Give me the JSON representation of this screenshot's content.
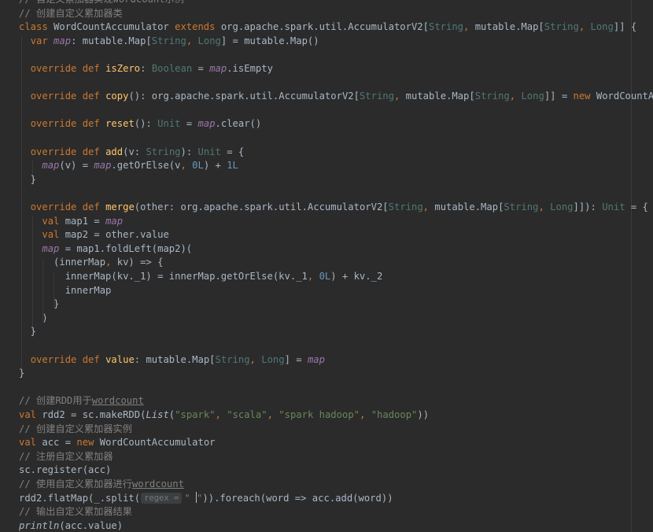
{
  "editor": {
    "theme_colors": {
      "background": "#2b2b2b",
      "text": "#a9b7c6",
      "keyword": "#cc7832",
      "type": "#507874",
      "function": "#ffc66d",
      "member": "#9876aa",
      "string": "#6a8759",
      "number": "#6897bb",
      "comment": "#808080"
    },
    "lines": [
      [
        {
          "t": "// 自定义累加器实现wordcount示例",
          "c": "c"
        }
      ],
      [
        {
          "t": "// 创建自定义累加器类",
          "c": "c"
        }
      ],
      [
        {
          "t": "class",
          "c": "k"
        },
        {
          "t": " WordCountAccumulator "
        },
        {
          "t": "extends",
          "c": "k"
        },
        {
          "t": " org.apache.spark.util.AccumulatorV2["
        },
        {
          "t": "String",
          "c": "t"
        },
        {
          "t": ", ",
          "c": "k"
        },
        {
          "t": "mutable.Map["
        },
        {
          "t": "String",
          "c": "t"
        },
        {
          "t": ", ",
          "c": "k"
        },
        {
          "t": "Long",
          "c": "t"
        },
        {
          "t": "]] {"
        }
      ],
      [
        {
          "t": "  "
        },
        {
          "t": "var",
          "c": "k"
        },
        {
          "t": " "
        },
        {
          "t": "map",
          "c": "m"
        },
        {
          "t": ": mutable.Map["
        },
        {
          "t": "String",
          "c": "t"
        },
        {
          "t": ", ",
          "c": "k"
        },
        {
          "t": "Long",
          "c": "t"
        },
        {
          "t": "] = mutable.Map()"
        }
      ],
      [],
      [
        {
          "t": "  "
        },
        {
          "t": "override def",
          "c": "k"
        },
        {
          "t": " "
        },
        {
          "t": "isZero",
          "c": "f"
        },
        {
          "t": ": "
        },
        {
          "t": "Boolean",
          "c": "t"
        },
        {
          "t": " = "
        },
        {
          "t": "map",
          "c": "m"
        },
        {
          "t": ".isEmpty"
        }
      ],
      [],
      [
        {
          "t": "  "
        },
        {
          "t": "override def",
          "c": "k"
        },
        {
          "t": " "
        },
        {
          "t": "copy",
          "c": "f"
        },
        {
          "t": "(): org.apache.spark.util.AccumulatorV2["
        },
        {
          "t": "String",
          "c": "t"
        },
        {
          "t": ", ",
          "c": "k"
        },
        {
          "t": "mutable.Map["
        },
        {
          "t": "String",
          "c": "t"
        },
        {
          "t": ", ",
          "c": "k"
        },
        {
          "t": "Long",
          "c": "t"
        },
        {
          "t": "]] = "
        },
        {
          "t": "new",
          "c": "k"
        },
        {
          "t": " WordCountAccumulator"
        }
      ],
      [],
      [
        {
          "t": "  "
        },
        {
          "t": "override def",
          "c": "k"
        },
        {
          "t": " "
        },
        {
          "t": "reset",
          "c": "f"
        },
        {
          "t": "(): "
        },
        {
          "t": "Unit",
          "c": "t"
        },
        {
          "t": " = "
        },
        {
          "t": "map",
          "c": "m"
        },
        {
          "t": ".clear()"
        }
      ],
      [],
      [
        {
          "t": "  "
        },
        {
          "t": "override def",
          "c": "k"
        },
        {
          "t": " "
        },
        {
          "t": "add",
          "c": "f"
        },
        {
          "t": "(v: "
        },
        {
          "t": "String",
          "c": "t"
        },
        {
          "t": "): "
        },
        {
          "t": "Unit",
          "c": "t"
        },
        {
          "t": " = {"
        }
      ],
      [
        {
          "t": "    "
        },
        {
          "t": "map",
          "c": "m"
        },
        {
          "t": "(v) = "
        },
        {
          "t": "map",
          "c": "m"
        },
        {
          "t": ".getOrElse(v"
        },
        {
          "t": ", ",
          "c": "k"
        },
        {
          "t": "0L",
          "c": "n"
        },
        {
          "t": ") + "
        },
        {
          "t": "1L",
          "c": "n"
        }
      ],
      [
        {
          "t": "  }"
        }
      ],
      [],
      [
        {
          "t": "  "
        },
        {
          "t": "override def",
          "c": "k"
        },
        {
          "t": " "
        },
        {
          "t": "merge",
          "c": "f"
        },
        {
          "t": "(other: org.apache.spark.util.AccumulatorV2["
        },
        {
          "t": "String",
          "c": "t"
        },
        {
          "t": ", ",
          "c": "k"
        },
        {
          "t": "mutable.Map["
        },
        {
          "t": "String",
          "c": "t"
        },
        {
          "t": ", ",
          "c": "k"
        },
        {
          "t": "Long",
          "c": "t"
        },
        {
          "t": "]]): "
        },
        {
          "t": "Unit",
          "c": "t"
        },
        {
          "t": " = {"
        }
      ],
      [
        {
          "t": "    "
        },
        {
          "t": "val",
          "c": "k"
        },
        {
          "t": " map1 = "
        },
        {
          "t": "map",
          "c": "m"
        }
      ],
      [
        {
          "t": "    "
        },
        {
          "t": "val",
          "c": "k"
        },
        {
          "t": " map2 = other.value"
        }
      ],
      [
        {
          "t": "    "
        },
        {
          "t": "map",
          "c": "m"
        },
        {
          "t": " = map1.foldLeft(map2)("
        }
      ],
      [
        {
          "t": "      (innerMap"
        },
        {
          "t": ", ",
          "c": "k"
        },
        {
          "t": "kv) => {"
        }
      ],
      [
        {
          "t": "        innerMap(kv._1) = innerMap.getOrElse(kv._1"
        },
        {
          "t": ", ",
          "c": "k"
        },
        {
          "t": "0L",
          "c": "n"
        },
        {
          "t": ") + kv._2"
        }
      ],
      [
        {
          "t": "        innerMap"
        }
      ],
      [
        {
          "t": "      }"
        }
      ],
      [
        {
          "t": "    )"
        }
      ],
      [
        {
          "t": "  }"
        }
      ],
      [],
      [
        {
          "t": "  "
        },
        {
          "t": "override def",
          "c": "k"
        },
        {
          "t": " "
        },
        {
          "t": "value",
          "c": "f"
        },
        {
          "t": ": mutable.Map["
        },
        {
          "t": "String",
          "c": "t"
        },
        {
          "t": ", ",
          "c": "k"
        },
        {
          "t": "Long",
          "c": "t"
        },
        {
          "t": "] = "
        },
        {
          "t": "map",
          "c": "m"
        }
      ],
      [
        {
          "t": "}"
        }
      ],
      [],
      [
        {
          "t": "// 创建RDD用于",
          "c": "c"
        },
        {
          "t": "wordcount",
          "c": "c u"
        }
      ],
      [
        {
          "t": "val",
          "c": "k"
        },
        {
          "t": " rdd2 = sc.makeRDD("
        },
        {
          "t": "List",
          "c": "i"
        },
        {
          "t": "("
        },
        {
          "t": "\"spark\"",
          "c": "s"
        },
        {
          "t": ", ",
          "c": "k"
        },
        {
          "t": "\"scala\"",
          "c": "s"
        },
        {
          "t": ", ",
          "c": "k"
        },
        {
          "t": "\"spark hadoop\"",
          "c": "s"
        },
        {
          "t": ", ",
          "c": "k"
        },
        {
          "t": "\"hadoop\"",
          "c": "s"
        },
        {
          "t": "))"
        }
      ],
      [
        {
          "t": "// 创建自定义累加器实例",
          "c": "c"
        }
      ],
      [
        {
          "t": "val",
          "c": "k"
        },
        {
          "t": " acc = "
        },
        {
          "t": "new",
          "c": "k"
        },
        {
          "t": " WordCountAccumulator"
        }
      ],
      [
        {
          "t": "// 注册自定义累加器",
          "c": "c"
        }
      ],
      [
        {
          "t": "sc.register(acc)"
        }
      ],
      [
        {
          "t": "// 使用自定义累加器进行",
          "c": "c"
        },
        {
          "t": "wordcount",
          "c": "c u"
        }
      ],
      [
        {
          "t": "rdd2.flatMap(_.split("
        },
        {
          "t": "regex =",
          "c": "hint"
        },
        {
          "t": "\" ",
          "c": "s"
        },
        {
          "t": "",
          "c": "caret"
        },
        {
          "t": "\"",
          "c": "s"
        },
        {
          "t": ")).foreach(word => acc.add(word))"
        }
      ],
      [
        {
          "t": "// 输出自定义累加器结果",
          "c": "c"
        }
      ],
      [
        {
          "t": "println",
          "c": "i"
        },
        {
          "t": "(acc.value)"
        }
      ]
    ]
  }
}
